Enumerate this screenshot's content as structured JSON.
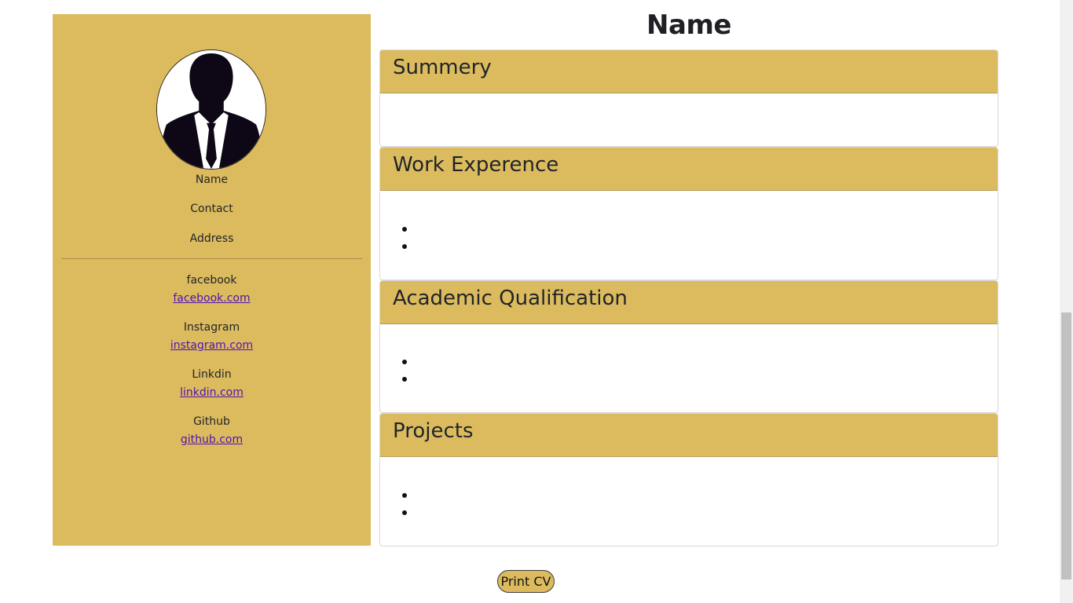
{
  "sidebar": {
    "name": "Name",
    "contact": "Contact",
    "address": "Address",
    "socials": [
      {
        "label": "facebook",
        "link": "facebook.com"
      },
      {
        "label": "Instagram",
        "link": "instagram.com"
      },
      {
        "label": "Linkdin",
        "link": "linkdin.com"
      },
      {
        "label": "Github",
        "link": "github.com"
      }
    ]
  },
  "main": {
    "title": "Name",
    "sections": [
      {
        "heading": "Summery"
      },
      {
        "heading": "Work Experence"
      },
      {
        "heading": "Academic Qualification"
      },
      {
        "heading": "Projects"
      }
    ]
  },
  "print_button": "Print CV",
  "colors": {
    "accent": "#dcbb5f",
    "link": "#4f12b5"
  }
}
